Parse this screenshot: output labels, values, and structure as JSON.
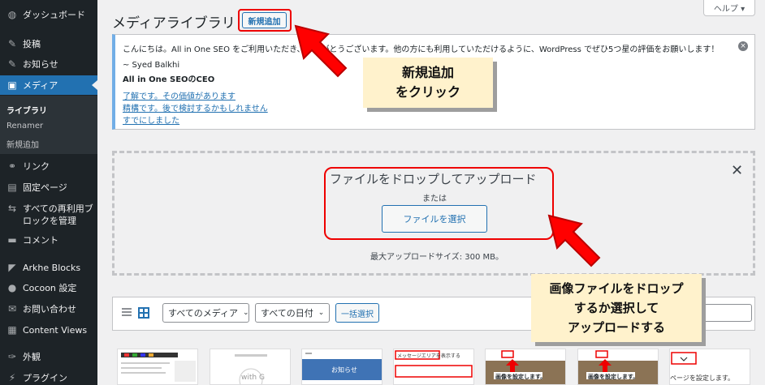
{
  "sidebar": {
    "items": [
      {
        "label": "ダッシュボード",
        "icon": "dashboard-icon",
        "glyph": "◍"
      },
      {
        "label": "投稿",
        "icon": "pin-icon",
        "glyph": "✎"
      },
      {
        "label": "お知らせ",
        "icon": "pin-icon",
        "glyph": "✎"
      },
      {
        "label": "メディア",
        "icon": "media-icon",
        "glyph": "▣"
      },
      {
        "label": "リンク",
        "icon": "link-icon",
        "glyph": "⚭"
      },
      {
        "label": "固定ページ",
        "icon": "page-icon",
        "glyph": "▤"
      },
      {
        "label": "すべての再利用ブ",
        "icon": "reusable-block-icon",
        "glyph": "⇆"
      },
      {
        "label": "コメント",
        "icon": "comment-icon",
        "glyph": "▬"
      },
      {
        "label": "Arkhe Blocks",
        "icon": "arkhe-icon",
        "glyph": "◤"
      },
      {
        "label": "Cocoon 設定",
        "icon": "cocoon-icon",
        "glyph": "●"
      },
      {
        "label": "お問い合わせ",
        "icon": "mail-icon",
        "glyph": "✉"
      },
      {
        "label": "Content Views",
        "icon": "grid-icon",
        "glyph": "▦"
      },
      {
        "label": "外観",
        "icon": "appearance-icon",
        "glyph": "✑"
      },
      {
        "label": "プラグイン",
        "icon": "plugin-icon",
        "glyph": "⚡"
      }
    ],
    "reusable_line2": "ロックを管理",
    "submenu": [
      {
        "label": "ライブラリ"
      },
      {
        "label": "Renamer"
      },
      {
        "label": "新規追加"
      }
    ]
  },
  "header": {
    "title": "メディアライブラリ",
    "add_new": "新規追加",
    "help": "ヘルプ ▾"
  },
  "notice": {
    "line1": "こんにちは。All in One SEO をご利用いただき、ありがとうございます。他の方にも利用していただけるように、WordPress でぜひ5つ星の評価をお願いします！",
    "author": "~ Syed Balkhi",
    "role": "All in One SEOのCEO",
    "link1": "了解です。その価値があります",
    "link2": "精構です。後で検討するかもしれません",
    "link3": "すでにしました",
    "close": "×"
  },
  "uploader": {
    "drop_text": "ファイルをドロップしてアップロード",
    "or": "または",
    "select_button": "ファイルを選択",
    "max_size": "最大アップロードサイズ: 300 MB。",
    "close": "✕"
  },
  "toolbar": {
    "filter_media": "すべてのメディア",
    "filter_date": "すべての日付",
    "bulk_select": "一括選択"
  },
  "annotations": {
    "callout1_line1": "新規追加",
    "callout1_line2": "をクリック",
    "callout2_line1": "画像ファイルをドロップ",
    "callout2_line2": "するか選択して",
    "callout2_line3": "アップロードする"
  },
  "thumbnails": [
    {
      "label": ""
    },
    {
      "label": "with G"
    },
    {
      "label": "お知らせ"
    },
    {
      "label": "メッセージエリアを表示する"
    },
    {
      "label": "画像を設定します。"
    },
    {
      "label": "画像を設定します。"
    },
    {
      "label": "ページを設定します。"
    }
  ]
}
